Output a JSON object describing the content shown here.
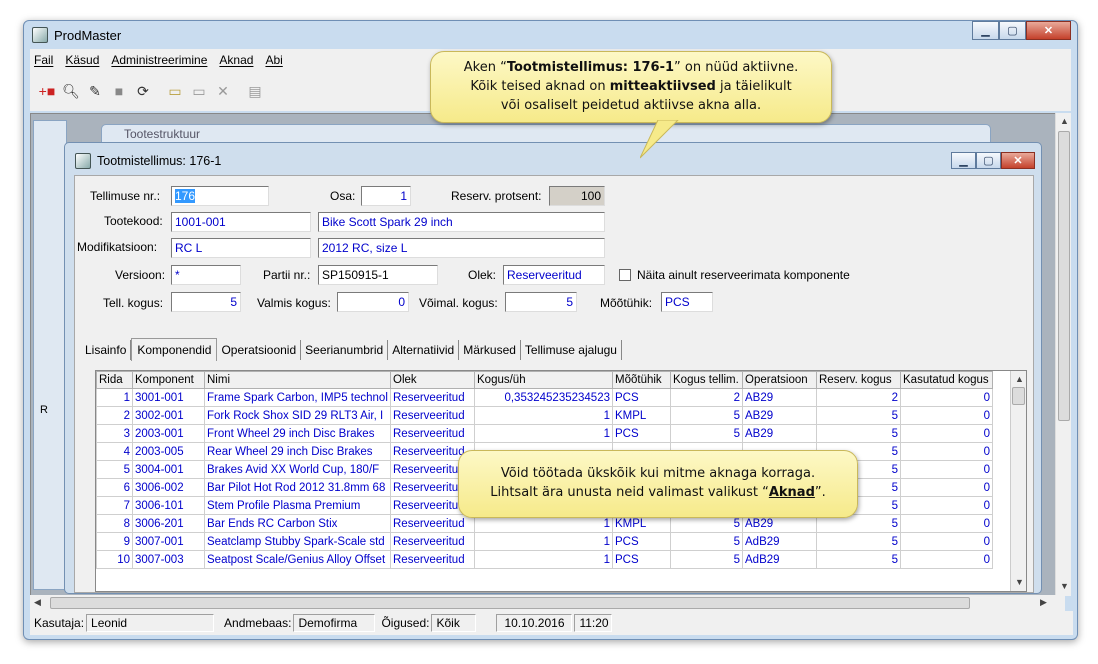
{
  "app": {
    "title": "ProdMaster"
  },
  "menu": [
    "Fail",
    "Käsud",
    "Administreerimine",
    "Aknad",
    "Abi"
  ],
  "bg_window": {
    "title": "Tootestruktuur",
    "label": "R"
  },
  "child": {
    "title": "Tootmistellimus: 176-1",
    "fields": {
      "tellimuse_nr_label": "Tellimuse nr.:",
      "tellimuse_nr": "176",
      "osa_label": "Osa:",
      "osa": "1",
      "reserv_label": "Reserv. protsent:",
      "reserv": "100",
      "tootekood_label": "Tootekood:",
      "tootekood": "1001-001",
      "tootekood_name": "Bike Scott Spark 29 inch",
      "modifikatsioon_label": "Modifikatsioon:",
      "modifikatsioon": "RC L",
      "modifikatsioon_name": "2012 RC, size L",
      "versioon_label": "Versioon:",
      "versioon": "*",
      "partii_label": "Partii nr.:",
      "partii": "SP150915-1",
      "olek_label": "Olek:",
      "olek": "Reserveeritud",
      "naita_label": "Näita ainult reserveerimata komponente",
      "tell_kogus_label": "Tell. kogus:",
      "tell_kogus": "5",
      "valmis_label": "Valmis kogus:",
      "valmis": "0",
      "voimal_label": "Võimal. kogus:",
      "voimal": "5",
      "mootuhik_label": "Mõõtühik:",
      "mootuhik": "PCS"
    },
    "tabs": [
      "Lisainfo",
      "Komponendid",
      "Operatsioonid",
      "Seerianumbrid",
      "Alternatiivid",
      "Märkused",
      "Tellimuse ajalugu"
    ],
    "columns": [
      "Rida",
      "Komponent",
      "Nimi",
      "Olek",
      "Kogus/üh",
      "Mõõtühik",
      "Kogus tellim.",
      "Operatsioon",
      "Reserv. kogus",
      "Kasutatud kogus"
    ],
    "rows": [
      [
        "1",
        "3001-001",
        "Frame Spark Carbon, IMP5 technol",
        "Reserveeritud",
        "0,353245235234523",
        "PCS",
        "2",
        "AB29",
        "2",
        "0"
      ],
      [
        "2",
        "3002-001",
        "Fork Rock Shox SID 29 RLT3 Air, I",
        "Reserveeritud",
        "1",
        "KMPL",
        "5",
        "AB29",
        "5",
        "0"
      ],
      [
        "3",
        "2003-001",
        "Front Wheel 29 inch Disc Brakes",
        "Reserveeritud",
        "1",
        "PCS",
        "5",
        "AB29",
        "5",
        "0"
      ],
      [
        "4",
        "2003-005",
        "Rear Wheel 29 inch Disc Brakes",
        "Reserveeritud",
        "",
        "",
        "",
        "",
        "5",
        "0"
      ],
      [
        "5",
        "3004-001",
        "Brakes Avid XX World Cup, 180/F",
        "Reserveeritud",
        "",
        "",
        "",
        "",
        "5",
        "0"
      ],
      [
        "6",
        "3006-002",
        "Bar Pilot Hot Rod 2012 31.8mm 68",
        "Reserveeritud",
        "",
        "",
        "",
        "",
        "5",
        "0"
      ],
      [
        "7",
        "3006-101",
        "Stem Profile Plasma Premium",
        "Reserveeritud",
        "",
        "",
        "",
        "",
        "5",
        "0"
      ],
      [
        "8",
        "3006-201",
        "Bar Ends RC Carbon Stix",
        "Reserveeritud",
        "1",
        "KMPL",
        "5",
        "AB29",
        "5",
        "0"
      ],
      [
        "9",
        "3007-001",
        "Seatclamp Stubby Spark-Scale std",
        "Reserveeritud",
        "1",
        "PCS",
        "5",
        "AdB29",
        "5",
        "0"
      ],
      [
        "10",
        "3007-003",
        "Seatpost Scale/Genius Alloy Offset",
        "Reserveeritud",
        "1",
        "PCS",
        "5",
        "AdB29",
        "5",
        "0"
      ]
    ]
  },
  "status": {
    "user_label": "Kasutaja:",
    "user": "Leonid",
    "db_label": "Andmebaas:",
    "db": "Demofirma",
    "rights_label": "Õigused:",
    "rights": "Kõik",
    "date": "10.10.2016",
    "time": "11:20"
  },
  "callout1": {
    "pre": "Aken “",
    "bold1": "Tootmistellimus: 176-1",
    "mid": "” on nüüd aktiivne.",
    "l2a": "Kõik teised aknad on ",
    "bold2": "mitteaktiivsed",
    "l2b": " ja täielikult",
    "l3": "või osaliselt peidetud aktiivse akna alla."
  },
  "callout2": {
    "l1": "Võid töötada ükskõik kui mitme aknaga korraga.",
    "l2a": "Lihtsalt ära unusta neid valimast valikust “",
    "bold": "Aknad",
    "l2b": "”."
  }
}
